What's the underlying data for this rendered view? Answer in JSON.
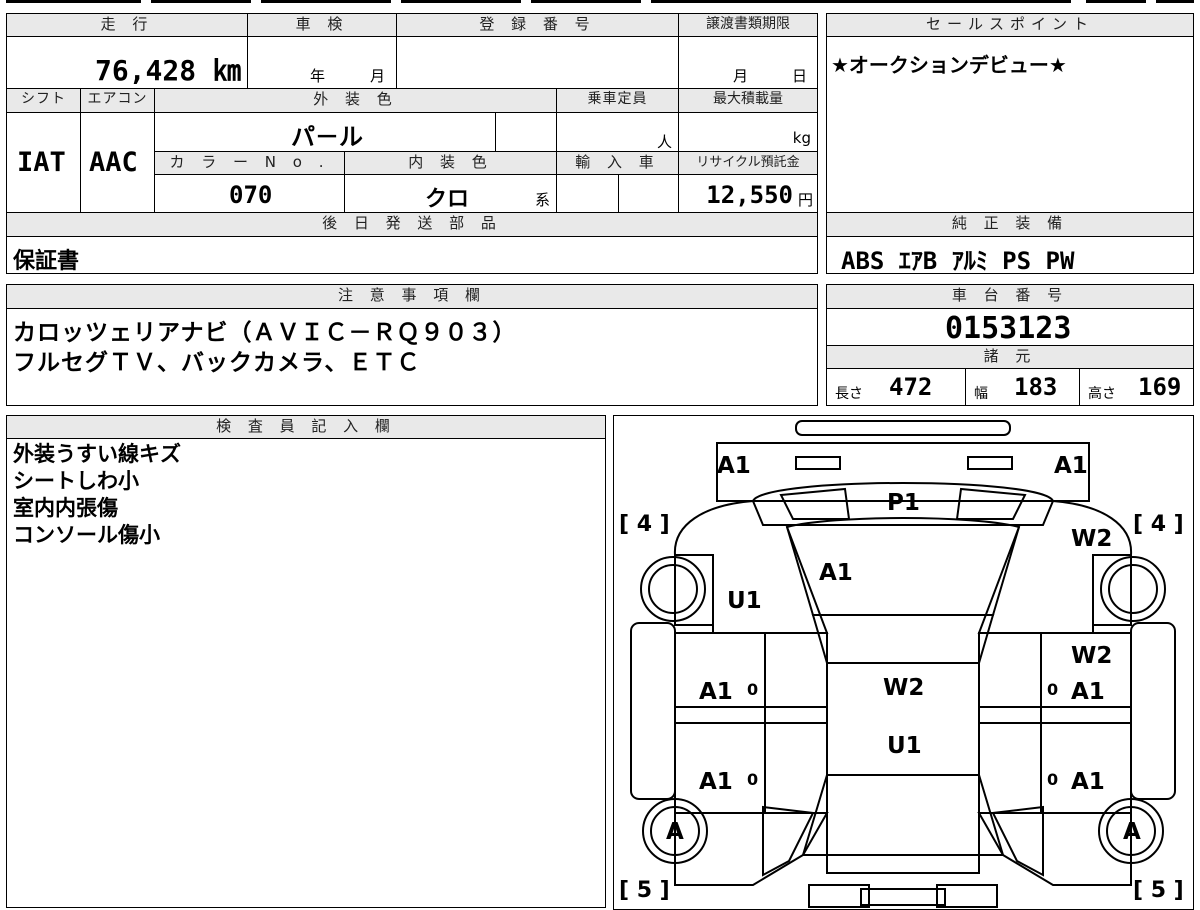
{
  "top": {
    "mileage_label": "走 行",
    "mileage_value": "76,428 ㎞",
    "inspection_label": "車 検",
    "inspection_year": "年",
    "inspection_month": "月",
    "registration_label": "登 録 番 号",
    "transfer_label": "譲渡書類期限",
    "transfer_month": "月",
    "transfer_day": "日",
    "shift_label": "シフト",
    "shift_value": "IAT",
    "ac_label": "エアコン",
    "ac_value": "AAC",
    "exterior_label": "外 装 色",
    "exterior_value": "パ－ル",
    "capacity_label": "乗車定員",
    "capacity_unit": "人",
    "load_label": "最大積載量",
    "load_unit": "kg",
    "color_no_label": "カ ラ ー N o .",
    "color_no_value": "070",
    "interior_label": "内 装 色",
    "interior_value": "クロ",
    "interior_suffix": "系",
    "import_label": "輸 入 車",
    "recycle_label": "リサイクル預託金",
    "recycle_value": "12,550",
    "recycle_unit": "円"
  },
  "sales": {
    "label": "セールスポイント",
    "text": "★オークションデビュー★"
  },
  "later_parts": {
    "label": "後 日 発 送 部 品",
    "value": "保証書"
  },
  "equipment": {
    "label": "純 正 装 備",
    "value": "ABS ｴｱB ｱﾙﾐ PS PW"
  },
  "notes": {
    "label": "注 意 事 項 欄",
    "line1": "カロッツェリアナビ（ＡＶＩＣ－ＲＱ９０３）",
    "line2": "フルセグＴＶ、バックカメラ、ＥＴＣ"
  },
  "chassis": {
    "label": "車 台 番 号",
    "value": "0153123"
  },
  "specs": {
    "label": "諸 元",
    "length_label": "長さ",
    "length_value": "472",
    "width_label": "幅",
    "width_value": "183",
    "height_label": "高さ",
    "height_value": "169"
  },
  "inspector": {
    "label": "検 査 員 記 入 欄",
    "lines": [
      "外装うすい線キズ",
      "シートしわ小",
      "室内内張傷",
      "コンソール傷小"
    ]
  },
  "diagram": {
    "marks": {
      "front_left": "A1",
      "front_right": "A1",
      "hood": "P1",
      "windshield_area": "A1",
      "left_fender": "U1",
      "right_fender": "W2",
      "right_front_door_top": "W2",
      "roof": "W2",
      "roof_rear": "U1",
      "left_front_door": "A1",
      "left_rear_door": "A1",
      "right_front_door": "A1",
      "right_rear_door": "A1",
      "left_rear_wheel": "A",
      "right_rear_wheel": "A",
      "left_door_zero_1": "0",
      "left_door_zero_2": "0",
      "right_door_zero_1": "0",
      "right_door_zero_2": "0"
    },
    "tires": {
      "front_left": "[ 4 ]",
      "front_right": "[ 4 ]",
      "rear_left": "[ 5 ]",
      "rear_right": "[ 5 ]"
    }
  }
}
